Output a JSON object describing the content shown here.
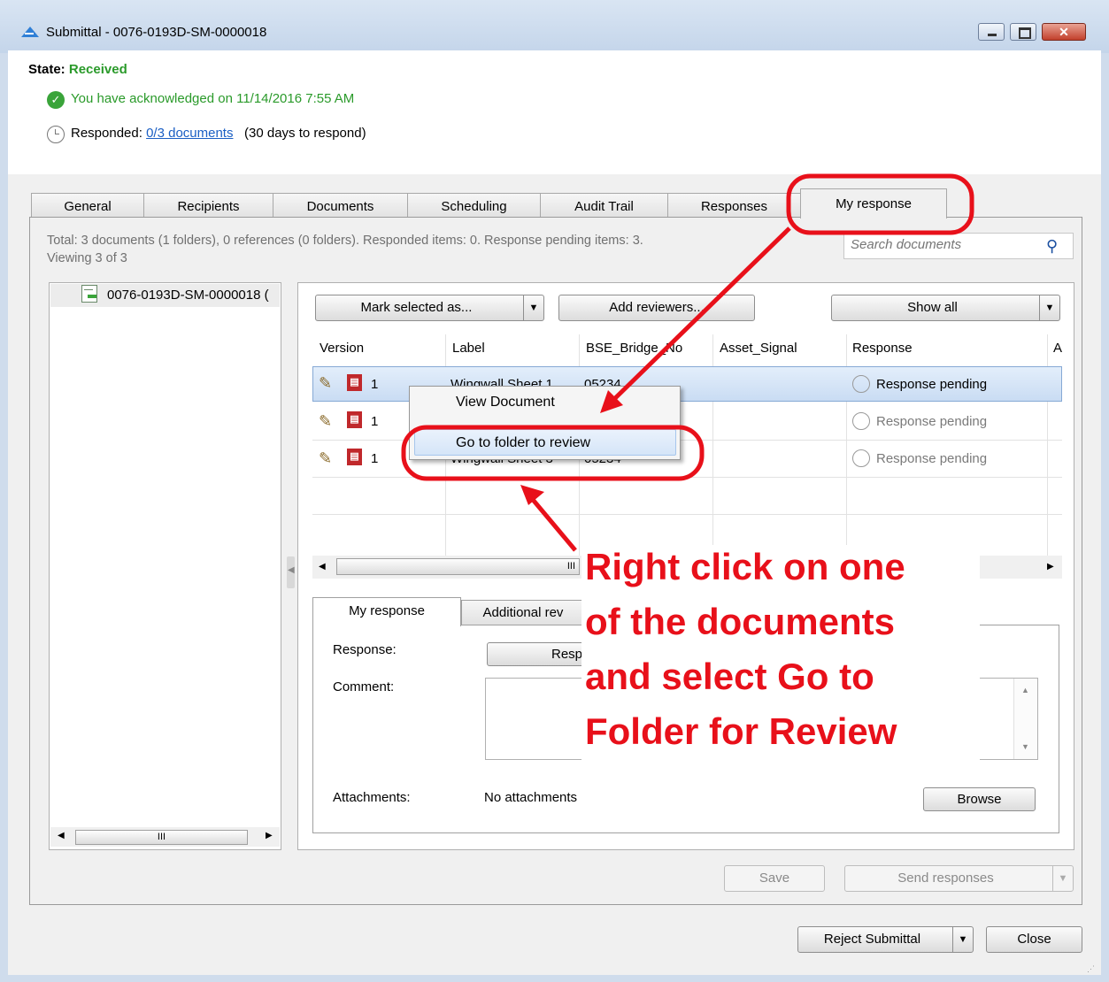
{
  "window": {
    "title": "Submittal - 0076-0193D-SM-0000018",
    "close_glyph": "✕"
  },
  "header": {
    "state_label": "State:",
    "state_value": "Received",
    "acknowledged_text": "You have acknowledged on 11/14/2016 7:55 AM",
    "responded_label": "Responded:",
    "responded_link": "0/3 documents",
    "days_to_respond": "(30 days to respond)"
  },
  "tabs": [
    "General",
    "Recipients",
    "Documents",
    "Scheduling",
    "Audit Trail",
    "Responses",
    "My response"
  ],
  "active_tab": "My response",
  "summary": {
    "line1": "Total: 3 documents (1 folders), 0 references (0 folders). Responded items: 0. Response pending items: 3.",
    "line2": "Viewing 3 of 3"
  },
  "search": {
    "placeholder": "Search documents"
  },
  "tree": {
    "item_label": "0076-0193D-SM-0000018 ("
  },
  "toolbar": {
    "mark_selected": "Mark selected as...",
    "add_reviewers": "Add reviewers...",
    "show_all": "Show all"
  },
  "grid": {
    "columns": [
      "Version",
      "Label",
      "BSE_Bridge_No",
      "Asset_Signal",
      "Response",
      "A"
    ],
    "rows": [
      {
        "version": "1",
        "label": "Wingwall Sheet 1",
        "bridge_no": "05234",
        "response": "Response pending"
      },
      {
        "version": "1",
        "label": "",
        "bridge_no": "",
        "response": "Response pending"
      },
      {
        "version": "1",
        "label": "Wingwall Sheet 3",
        "bridge_no": "05234",
        "response": "Response pending"
      }
    ]
  },
  "context_menu": {
    "items": [
      "View Document",
      "Go to folder to review"
    ]
  },
  "response_tabs": [
    "My response",
    "Additional rev"
  ],
  "response_form": {
    "response_label": "Response:",
    "response_button": "Resp",
    "comment_label": "Comment:",
    "attachments_label": "Attachments:",
    "attachments_value": "No attachments",
    "browse": "Browse"
  },
  "actions": {
    "save": "Save",
    "send_responses": "Send responses",
    "reject_submittal": "Reject Submittal",
    "close": "Close"
  },
  "scroll": {
    "thumb_grip": "III"
  },
  "annotation": {
    "lines": [
      "Right click on one",
      "of the documents",
      "and select Go to",
      "Folder for Review"
    ],
    "color": "#e8101a"
  }
}
